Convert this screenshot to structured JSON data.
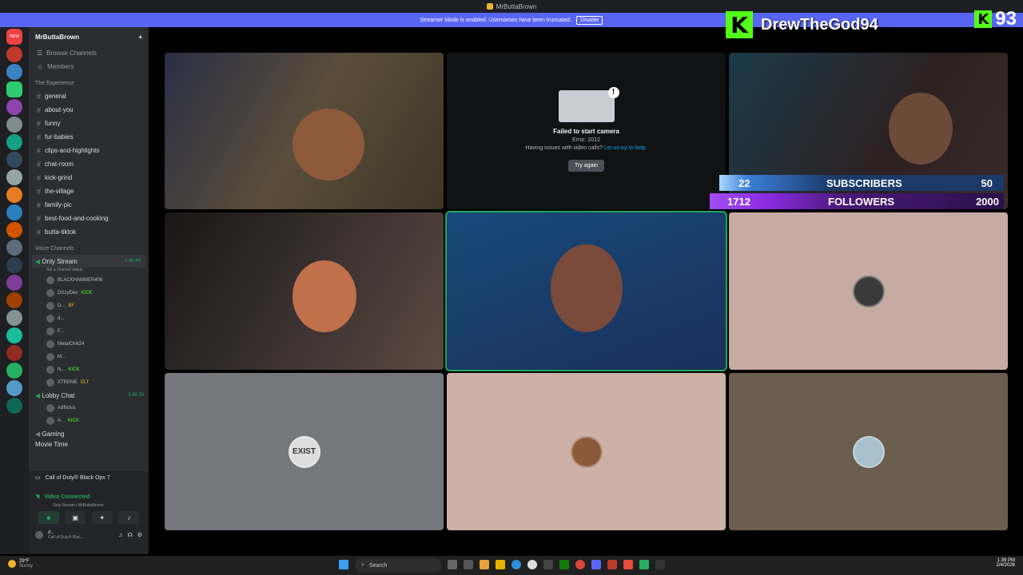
{
  "window": {
    "title": "MrButtaBrown"
  },
  "streamer_banner": {
    "text": "Streamer Mode is enabled. Usernames have been truncated.",
    "button": "Disable"
  },
  "guild_badge": "NEW",
  "sidebar": {
    "server_name": "MrButtaBrown",
    "nav": [
      {
        "label": "Browse Channels"
      },
      {
        "label": "Members"
      }
    ],
    "category_text": "The Experience",
    "text_channels": [
      {
        "label": "general"
      },
      {
        "label": "about-you"
      },
      {
        "label": "funny"
      },
      {
        "label": "fur-babies"
      },
      {
        "label": "clips-and-highlights"
      },
      {
        "label": "chat-room"
      },
      {
        "label": "kick-grind"
      },
      {
        "label": "the-village"
      },
      {
        "label": "family-pic"
      },
      {
        "label": "best-food-and-cooking"
      },
      {
        "label": "butta-tiktok"
      }
    ],
    "category_voice": "Voice Channels",
    "voice": {
      "only_stream": {
        "label": "Only Stream",
        "time": "1:40:49",
        "status": "Set a channel status"
      },
      "users": [
        {
          "name": "BLACKHAMMER406",
          "tag": ""
        },
        {
          "name": "DizzyDev",
          "tag": "KICK"
        },
        {
          "name": "D...",
          "tag": "BF"
        },
        {
          "name": "d...",
          "tag": ""
        },
        {
          "name": "F...",
          "tag": ""
        },
        {
          "name": "MetalChik24",
          "tag": ""
        },
        {
          "name": "M...",
          "tag": ""
        },
        {
          "name": "N...",
          "tag": "KICK"
        },
        {
          "name": "XTREME",
          "tag": "ELT"
        }
      ],
      "lobby": {
        "label": "Lobby Chat",
        "time": "3:49:28"
      },
      "lobby_users": [
        {
          "name": "Adflictus",
          "tag": ""
        },
        {
          "name": "A...",
          "tag": "KICK"
        }
      ],
      "gaming": "Gaming",
      "movie": "Movie Time"
    }
  },
  "voice_panel": {
    "activity": "Call of Duty® Black Ops 7",
    "status": "Video Connected",
    "location": "Only Stream / MrButtaBrown",
    "user_name": "d...",
    "user_sub": "Call of Duty® Blac..."
  },
  "camera_error": {
    "title": "Failed to start camera",
    "error": "Error: 2012",
    "help_prefix": "Having issues with video calls?",
    "help_link": "Let us try to help.",
    "button": "Try again"
  },
  "tile_text": {
    "exist": "EXIST"
  },
  "kick_overlay": {
    "name": "DrewTheGod94",
    "score": "93",
    "k": "K"
  },
  "goals": {
    "subscribers": {
      "label": "SUBSCRIBERS",
      "current": "22",
      "target": "50"
    },
    "followers": {
      "label": "FOLLOWERS",
      "current": "1712",
      "target": "2000"
    }
  },
  "taskbar": {
    "weather_temp": "29°F",
    "weather_desc": "Sunny",
    "search": "Search",
    "time": "1:39 PM",
    "date": "2/4/2026"
  },
  "colors": {
    "accent": "#5865f2",
    "kick_green": "#53fc18",
    "voice_green": "#23a55a"
  }
}
